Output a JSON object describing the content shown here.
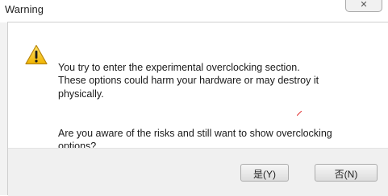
{
  "window": {
    "title": "Warning",
    "close_glyph": "✕"
  },
  "message": {
    "paragraph1": "You try to enter the experimental overclocking section.\nThese options could harm your hardware or may destroy it\nphysically.",
    "paragraph2": "Are you aware of the risks and still want to show overclocking\noptions?"
  },
  "buttons": {
    "yes_label": "是(Y)",
    "no_label": "否(N)"
  },
  "icon": {
    "name": "warning-icon",
    "fill": "#f4c430",
    "stroke": "#b8860b"
  }
}
